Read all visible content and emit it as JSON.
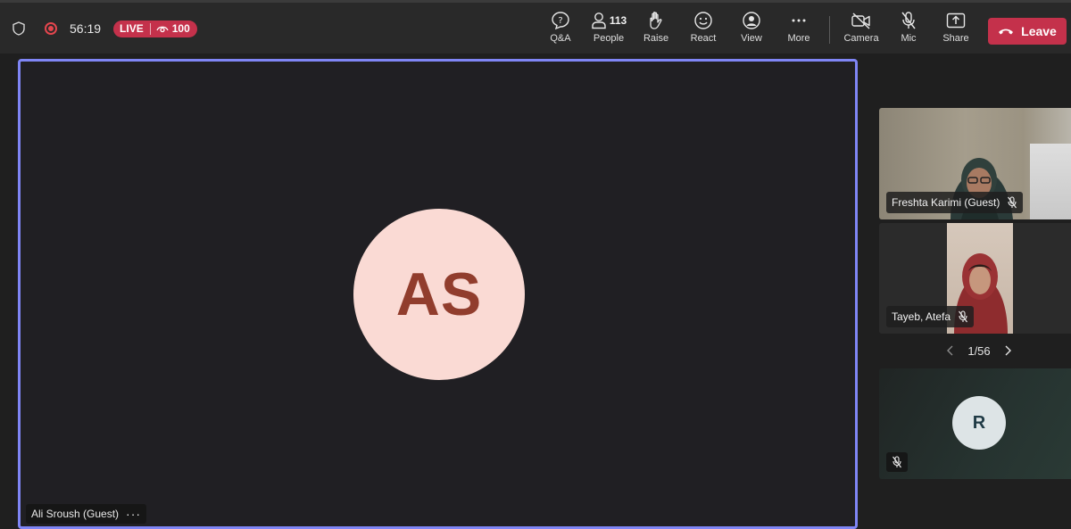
{
  "toolbar": {
    "timer": "56:19",
    "live_label": "LIVE",
    "viewers": "100",
    "buttons": {
      "qa": "Q&A",
      "people": "People",
      "people_count": "113",
      "raise": "Raise",
      "react": "React",
      "view": "View",
      "more": "More",
      "camera": "Camera",
      "mic": "Mic",
      "share": "Share",
      "leave": "Leave"
    }
  },
  "stage": {
    "initials": "AS",
    "name": "Ali Sroush (Guest)",
    "more_icon": "···"
  },
  "gallery": {
    "tiles": [
      {
        "name": "Freshta Karimi (Guest)"
      },
      {
        "name": "Tayeb, Atefa"
      },
      {
        "initials": "R"
      }
    ],
    "pager": "1/56"
  },
  "colors": {
    "accent_border": "#7f85f5",
    "live": "#c4314b",
    "leave": "#c4314b",
    "avatar_bg": "#fadad4",
    "avatar_text": "#913d2d"
  }
}
